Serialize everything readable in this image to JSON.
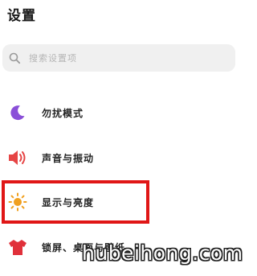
{
  "header": {
    "title": "设置"
  },
  "search": {
    "placeholder": "搜索设置项",
    "icon": "search-icon"
  },
  "menu": {
    "items": [
      {
        "id": "do-not-disturb",
        "label": "勿扰模式",
        "icon": "moon-icon",
        "icon_color": "#8a4fd8"
      },
      {
        "id": "sound",
        "label": "声音与振动",
        "icon": "speaker-icon",
        "icon_color": "#e64545"
      },
      {
        "id": "display",
        "label": "显示与亮度",
        "icon": "sun-icon",
        "icon_color": "#f0a020",
        "highlighted": true
      },
      {
        "id": "wallpaper",
        "label": "锁屏、桌面与壁纸",
        "icon": "shirt-icon",
        "icon_color": "#e0303a"
      }
    ]
  },
  "annotation": {
    "highlight_color": "#e01616"
  },
  "watermark": {
    "text": "hubeihong.com"
  }
}
